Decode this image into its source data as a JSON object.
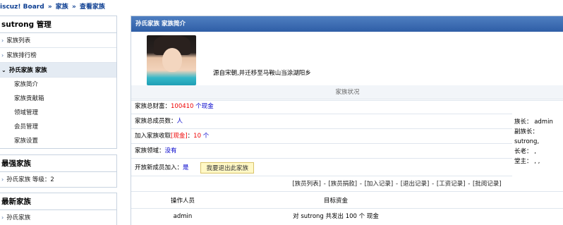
{
  "breadcrumb": {
    "site": "iscuz! Board",
    "sep1": "»",
    "family": "家族",
    "sep2": "»",
    "current": "查看家族"
  },
  "sidebar": {
    "manage_title": "sutrong 管理",
    "items": [
      {
        "label": "家族列表"
      },
      {
        "label": "家族排行榜"
      },
      {
        "label": "孙氏家族 家族"
      }
    ],
    "sub_items": [
      {
        "label": "家族简介"
      },
      {
        "label": "家族贡献箱"
      },
      {
        "label": "领域管理"
      },
      {
        "label": "会员管理"
      },
      {
        "label": "家族设置"
      }
    ],
    "strongest_title": "最强家族",
    "strongest_item": "孙氏家族 等级：2",
    "newest_title": "最新家族",
    "newest_item": "孙氏家族"
  },
  "main": {
    "header": "孙氏家族 家族简介",
    "intro_text": "源自宋朝,并迁移至马鞍山当涂湖阳乡",
    "status_title": "家族状况",
    "wealth_label": "家族总财富：",
    "wealth_value": "100410",
    "wealth_unit": "个",
    "wealth_currency": "现金",
    "members_label": "家族总成员数：",
    "members_value": "人",
    "fee_label": "加入家族收取",
    "fee_currency": "[现金]",
    "fee_colon": "：",
    "fee_value": "10",
    "fee_unit": "个",
    "territory_label": "家族领域：",
    "territory_value": "没有",
    "open_label": "开放新成员加入：",
    "open_value": "是",
    "leave_button": "我要退出此家族",
    "leaders": {
      "chief": "族长： admin",
      "vice": "副族长： sutrong,",
      "elder": "长老： ,",
      "master": "堂主： , ,"
    },
    "records": {
      "members": "[族员列表]",
      "donations": "[族员捐款]",
      "joins": "[加入记录]",
      "leaves": "[退出记录]",
      "wages": "[工资记录]",
      "approvals": "[批阅记录]",
      "sep": "-"
    },
    "table": {
      "headers": [
        "操作人员",
        "目标资金"
      ],
      "rows": [
        [
          "admin",
          "对 sutrong 共发出 100 个 现金"
        ]
      ]
    }
  },
  "colors": {
    "header_blue": "#2f5ea6",
    "link_blue": "#0b3d91",
    "value_red": "#ee0000"
  }
}
